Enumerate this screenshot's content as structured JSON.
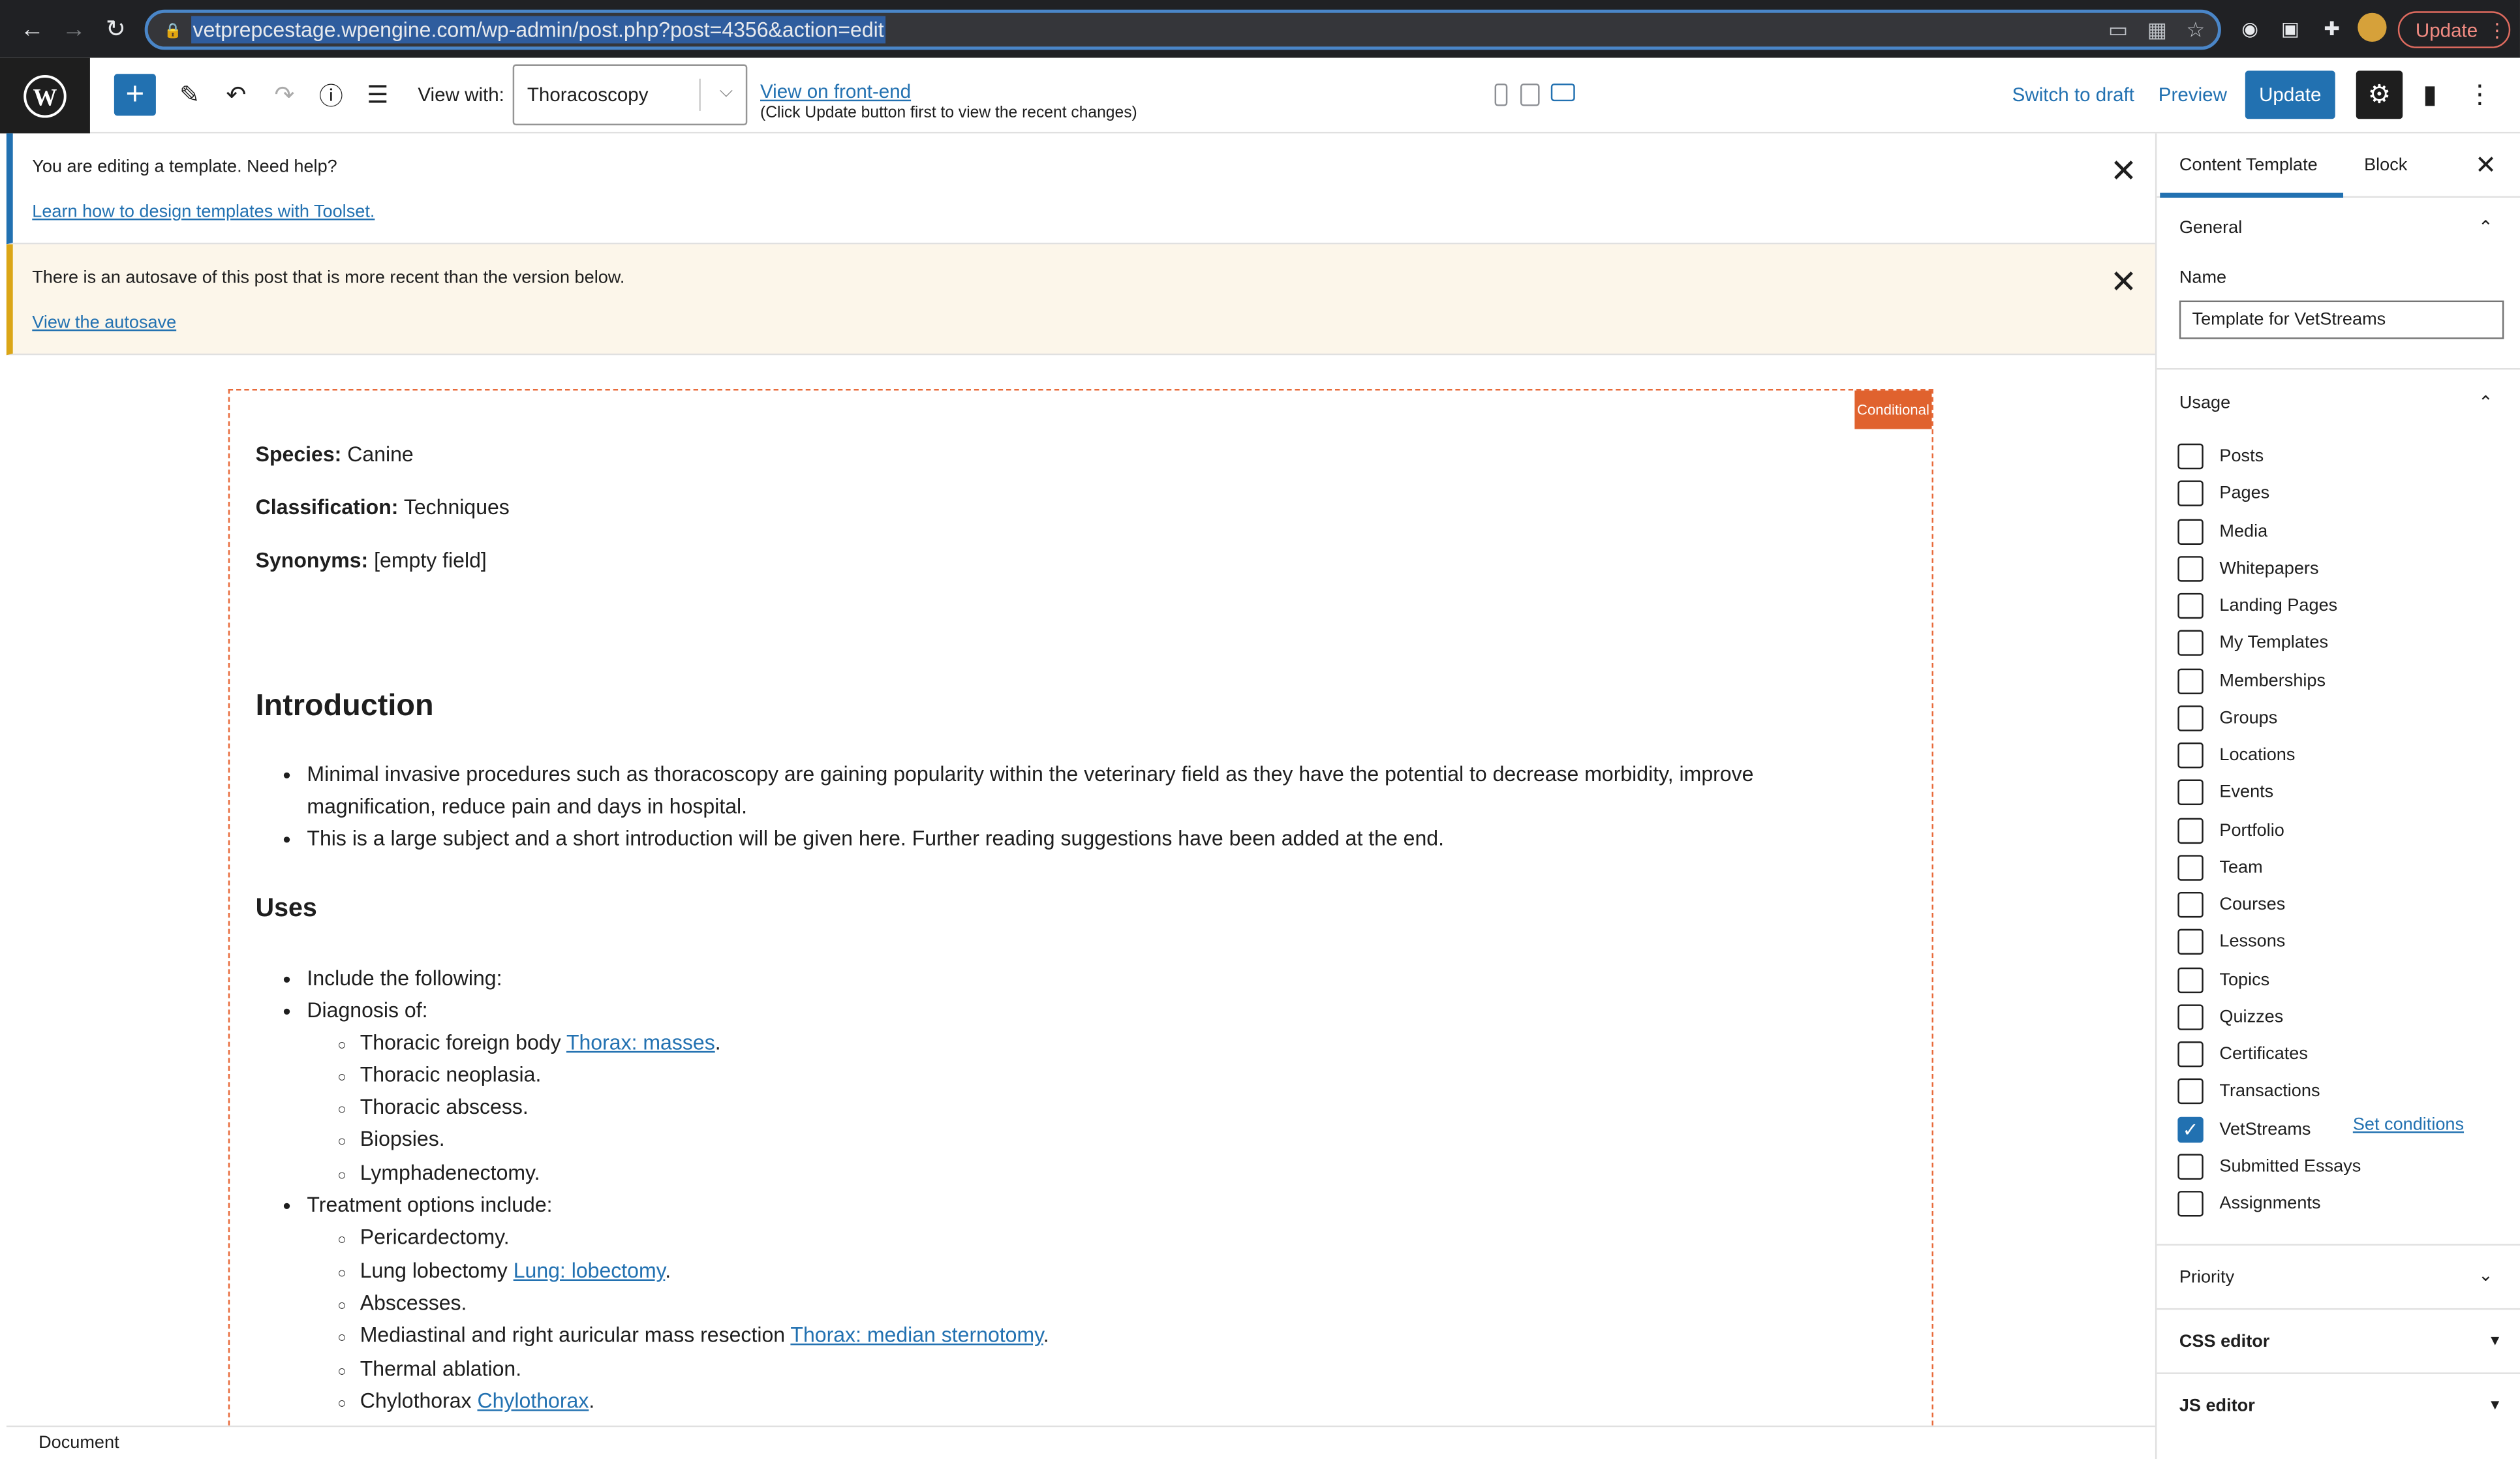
{
  "browser": {
    "url": "vetprepcestage.wpengine.com/wp-admin/post.php?post=4356&action=edit",
    "update_label": "Update"
  },
  "toolbar": {
    "view_with_label": "View with:",
    "view_with_value": "Thoracoscopy",
    "front_end_link": "View on front-end",
    "front_end_note": "(Click Update button first to view the recent changes)",
    "switch_to_draft": "Switch to draft",
    "preview": "Preview",
    "update": "Update"
  },
  "notices": {
    "template": {
      "text": "You are editing a template. Need help?",
      "link": "Learn how to design templates with Toolset."
    },
    "autosave": {
      "text": "There is an autosave of this post that is more recent than the version below.",
      "link": "View the autosave"
    }
  },
  "content": {
    "badge": "Conditional",
    "species_label": "Species:",
    "species_value": "Canine",
    "classification_label": "Classification:",
    "classification_value": "Techniques",
    "synonyms_label": "Synonyms:",
    "synonyms_value": "[empty field]",
    "intro_heading": "Introduction",
    "intro_bullets": [
      "Minimal invasive procedures such as thoracoscopy are gaining popularity within the veterinary field as they have the potential to decrease morbidity, improve",
      "magnification, reduce pain and days in hospital.",
      "This is a large subject and a short introduction will be given here. Further reading suggestions have been added at the end."
    ],
    "uses_heading": "Uses",
    "uses": {
      "include": "Include the following:",
      "diagnosis": "Diagnosis of:",
      "diag_items": [
        {
          "text": "Thoracic foreign body ",
          "link": "Thorax: masses",
          "after": "."
        },
        {
          "text": "Thoracic neoplasia.",
          "link": "",
          "after": ""
        },
        {
          "text": "Thoracic abscess.",
          "link": "",
          "after": ""
        },
        {
          "text": "Biopsies.",
          "link": "",
          "after": ""
        },
        {
          "text": "Lymphadenectomy.",
          "link": "",
          "after": ""
        }
      ],
      "treatment": "Treatment options include:",
      "treat_items": [
        {
          "text": "Pericardectomy.",
          "link": "",
          "after": ""
        },
        {
          "text": "Lung lobectomy ",
          "link": "Lung: lobectomy",
          "after": "."
        },
        {
          "text": "Abscesses.",
          "link": "",
          "after": ""
        },
        {
          "text": "Mediastinal and right auricular mass resection ",
          "link": "Thorax: median sternotomy",
          "after": "."
        },
        {
          "text": "Thermal ablation.",
          "link": "",
          "after": ""
        },
        {
          "text": "Chylothorax ",
          "link": "Chylothorax",
          "after": "."
        }
      ]
    }
  },
  "statusbar": {
    "label": "Document"
  },
  "sidebar": {
    "tab_content_template": "Content Template",
    "tab_block": "Block",
    "general_title": "General",
    "name_label": "Name",
    "name_value": "Template for VetStreams",
    "usage_title": "Usage",
    "usage_items": [
      {
        "label": "Posts",
        "checked": false
      },
      {
        "label": "Pages",
        "checked": false
      },
      {
        "label": "Media",
        "checked": false
      },
      {
        "label": "Whitepapers",
        "checked": false
      },
      {
        "label": "Landing Pages",
        "checked": false
      },
      {
        "label": "My Templates",
        "checked": false
      },
      {
        "label": "Memberships",
        "checked": false
      },
      {
        "label": "Groups",
        "checked": false
      },
      {
        "label": "Locations",
        "checked": false
      },
      {
        "label": "Events",
        "checked": false
      },
      {
        "label": "Portfolio",
        "checked": false
      },
      {
        "label": "Team",
        "checked": false
      },
      {
        "label": "Courses",
        "checked": false
      },
      {
        "label": "Lessons",
        "checked": false
      },
      {
        "label": "Topics",
        "checked": false
      },
      {
        "label": "Quizzes",
        "checked": false
      },
      {
        "label": "Certificates",
        "checked": false
      },
      {
        "label": "Transactions",
        "checked": false
      },
      {
        "label": "VetStreams",
        "checked": true
      },
      {
        "label": "Submitted Essays",
        "checked": false
      },
      {
        "label": "Assignments",
        "checked": false
      }
    ],
    "set_conditions": "Set conditions",
    "priority_title": "Priority",
    "css_editor_title": "CSS editor",
    "js_editor_title": "JS editor"
  }
}
